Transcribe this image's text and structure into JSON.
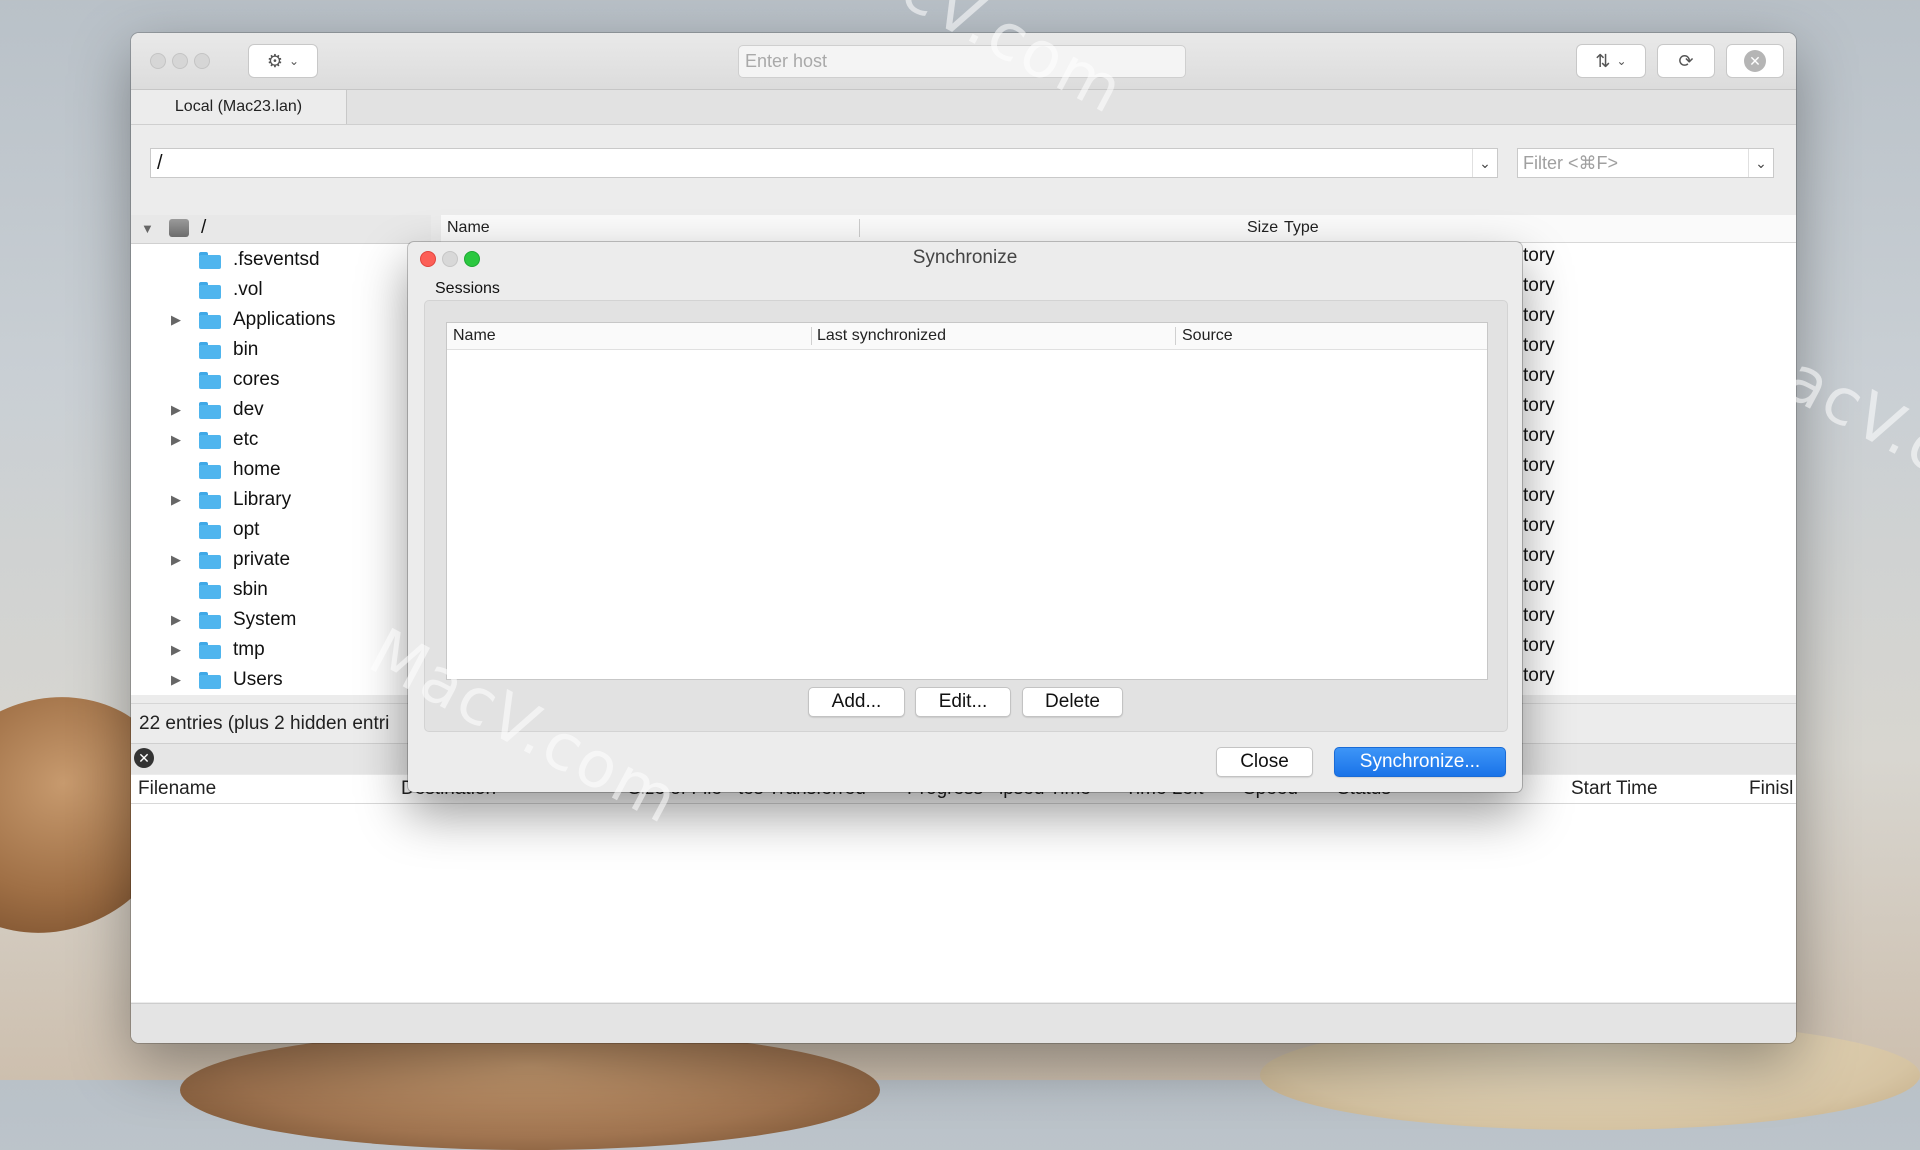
{
  "window": {
    "host_placeholder": "Enter host",
    "tab_label": "Local (Mac23.lan)",
    "path_value": "/",
    "filter_placeholder": "Filter <⌘F>"
  },
  "tree": {
    "root": "/",
    "items": [
      {
        "label": ".fseventsd",
        "expandable": false
      },
      {
        "label": ".vol",
        "expandable": false
      },
      {
        "label": "Applications",
        "expandable": true
      },
      {
        "label": "bin",
        "expandable": false
      },
      {
        "label": "cores",
        "expandable": false
      },
      {
        "label": "dev",
        "expandable": true
      },
      {
        "label": "etc",
        "expandable": true
      },
      {
        "label": "home",
        "expandable": false
      },
      {
        "label": "Library",
        "expandable": true
      },
      {
        "label": "opt",
        "expandable": false
      },
      {
        "label": "private",
        "expandable": true
      },
      {
        "label": "sbin",
        "expandable": false
      },
      {
        "label": "System",
        "expandable": true
      },
      {
        "label": "tmp",
        "expandable": true
      },
      {
        "label": "Users",
        "expandable": true
      }
    ]
  },
  "list": {
    "col_name": "Name",
    "col_size": "Size",
    "col_type": "Type",
    "type_values": [
      "tory",
      "tory",
      "tory",
      "tory",
      "tory",
      "tory",
      "tory",
      "tory",
      "tory",
      "tory",
      "tory",
      "tory",
      "tory",
      "tory",
      "tory"
    ]
  },
  "status_text": "22 entries (plus 2 hidden entri",
  "transfers": {
    "col_filename": "Filename",
    "col_destination": "Destination",
    "col_size": "Size of File",
    "col_bytes": "tes Transferred",
    "col_progress": "Progress",
    "col_elapsed": "lpsed Time",
    "col_left": "Time Left",
    "col_speed": "Speed",
    "col_status": "Status",
    "col_start": "Start Time",
    "col_finish": "Finisl"
  },
  "dialog": {
    "title": "Synchronize",
    "sessions_label": "Sessions",
    "col_name": "Name",
    "col_last_sync": "Last synchronized",
    "col_source": "Source",
    "add_label": "Add...",
    "edit_label": "Edit...",
    "delete_label": "Delete",
    "close_label": "Close",
    "synchronize_label": "Synchronize..."
  },
  "watermark": "MacV.com",
  "colors": {
    "accent": "#1a73e8",
    "close_red": "#fc5f57",
    "zoom_green": "#2bc840",
    "folder_blue": "#4fb5ee"
  }
}
